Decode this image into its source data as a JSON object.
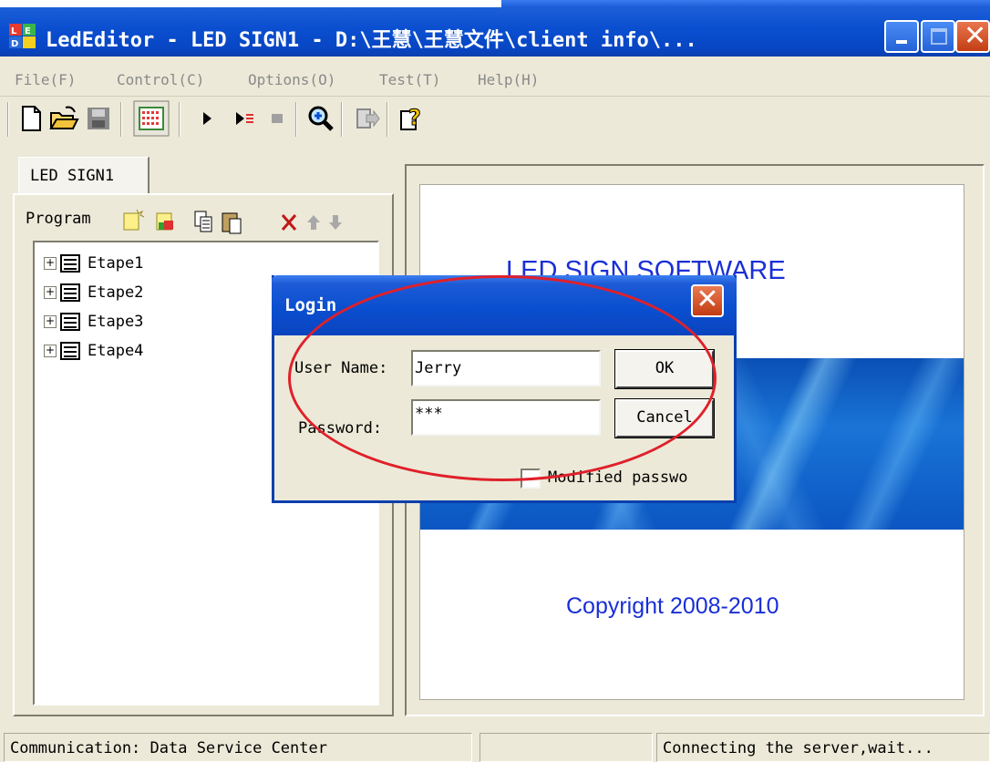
{
  "window": {
    "title": "LedEditor - LED SIGN1 - D:\\王慧\\王慧文件\\client info\\...",
    "app_icon": "led-editor-icon",
    "controls": [
      "minimize-icon",
      "maximize-icon",
      "close-icon"
    ]
  },
  "menu": [
    "File(F)",
    "Control(C)",
    "Options(O)",
    "Test(T)",
    "Help(H)"
  ],
  "toolbar": {
    "icons": [
      "new-document-icon",
      "open-folder-icon",
      "save-icon",
      "led-grid-icon",
      "play-icon",
      "play-step-icon",
      "stop-icon",
      "zoom-icon",
      "export-icon",
      "help-icon"
    ]
  },
  "left_panel": {
    "tab": "LED SIGN1",
    "program_label": "Program",
    "program_icons": [
      "new-program-icon",
      "new-program-color-icon",
      "copy-icon",
      "paste-icon",
      "delete-icon",
      "move-up-icon",
      "move-down-icon"
    ],
    "tree": [
      "Etape1",
      "Etape2",
      "Etape3",
      "Etape4"
    ]
  },
  "preview": {
    "title": "LED SIGN SOFTWARE",
    "copyright": "Copyright 2008-2010"
  },
  "dialog": {
    "title": "Login",
    "username_label": "User Name:",
    "username_value": "Jerry",
    "password_label": "Password:",
    "password_value": "***",
    "ok": "OK",
    "cancel": "Cancel",
    "modified_password": "Modified passwo",
    "highlight_color": "#e0202a"
  },
  "status": {
    "left": "Communication: Data Service Center",
    "middle": "",
    "right": "Connecting the server,wait..."
  }
}
